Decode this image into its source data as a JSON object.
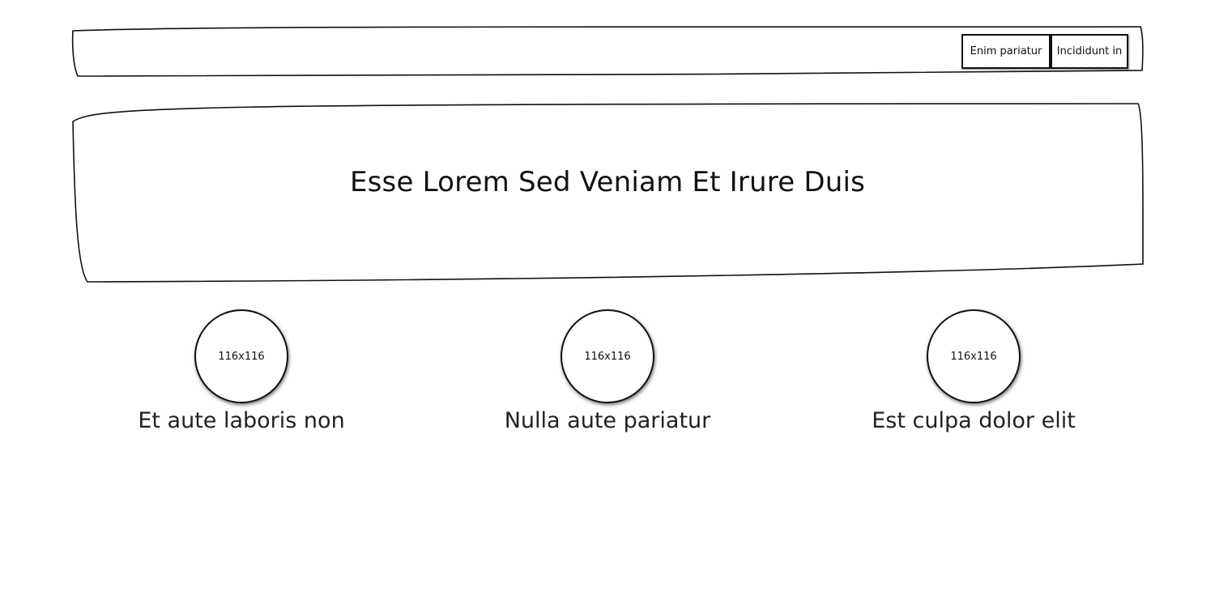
{
  "nav": {
    "buttons": [
      {
        "label": "Enim pariatur"
      },
      {
        "label": "Incididunt in"
      }
    ]
  },
  "hero": {
    "title": "Esse Lorem Sed Veniam Et Irure Duis"
  },
  "features": [
    {
      "image_label": "116x116",
      "caption": "Et aute laboris non"
    },
    {
      "image_label": "116x116",
      "caption": "Nulla aute pariatur"
    },
    {
      "image_label": "116x116",
      "caption": "Est culpa dolor elit"
    }
  ]
}
